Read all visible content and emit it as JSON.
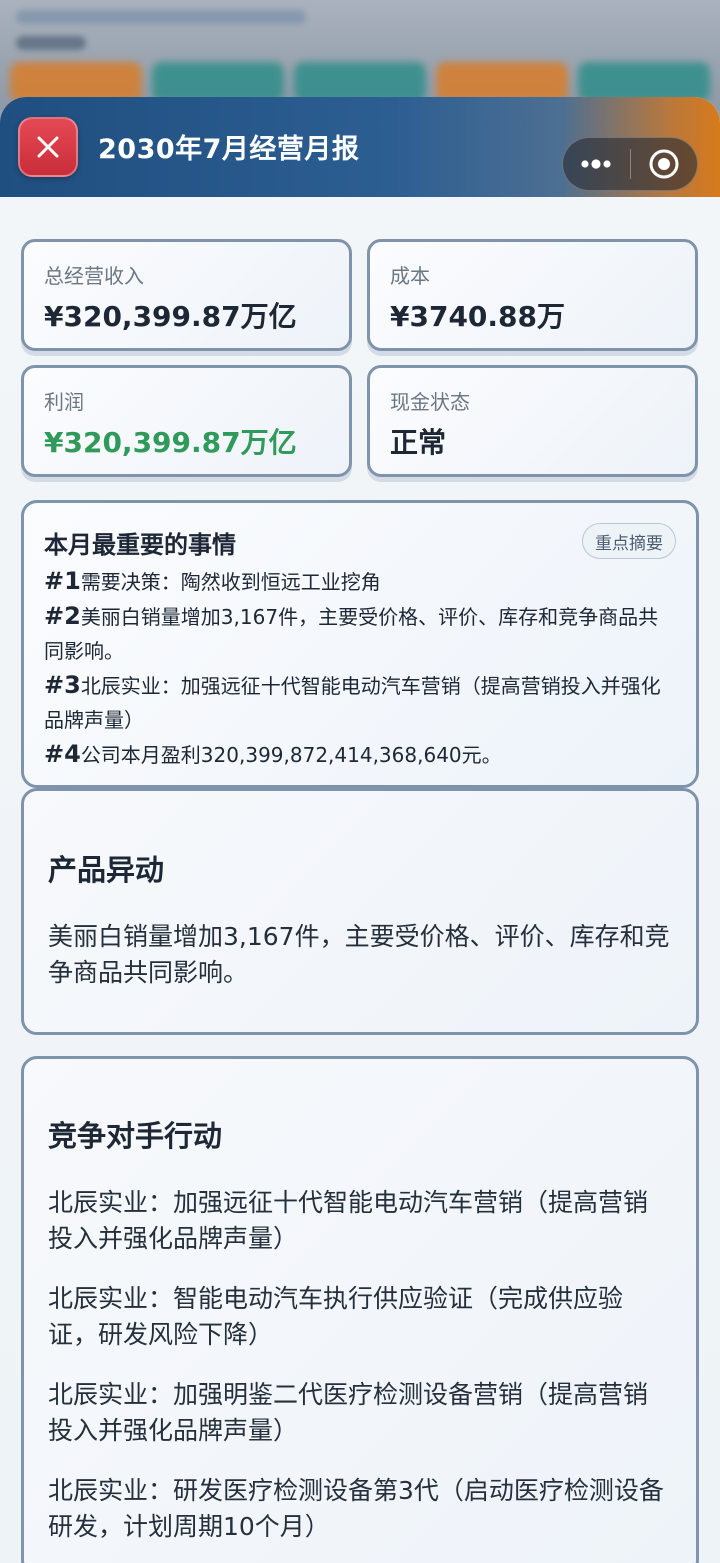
{
  "header": {
    "title": "2030年7月经营月报"
  },
  "stats": [
    {
      "label": "总经营收入",
      "value": "¥320,399.87万亿"
    },
    {
      "label": "成本",
      "value": "¥3740.88万"
    },
    {
      "label": "利润",
      "value": "¥320,399.87万亿"
    },
    {
      "label": "现金状态",
      "value": "正常"
    }
  ],
  "highlights": {
    "title": "本月最重要的事情",
    "badge": "重点摘要",
    "items": [
      {
        "num": "#1",
        "text": "需要决策：陶然收到恒远工业挖角"
      },
      {
        "num": "#2",
        "text": "美丽白销量增加3,167件，主要受价格、评价、库存和竞争商品共同影响。"
      },
      {
        "num": "#3",
        "text": "北辰实业：加强远征十代智能电动汽车营销（提高营销投入并强化品牌声量）"
      },
      {
        "num": "#4",
        "text": "公司本月盈利320,399,872,414,368,640元。"
      }
    ]
  },
  "product_section": {
    "title": "产品异动",
    "text": "美丽白销量增加3,167件，主要受价格、评价、库存和竞争商品共同影响。"
  },
  "competitor_section": {
    "title": "竞争对手行动",
    "items": [
      "北辰实业：加强远征十代智能电动汽车营销（提高营销投入并强化品牌声量）",
      "北辰实业：智能电动汽车执行供应验证（完成供应验证，研发风险下降）",
      "北辰实业：加强明鉴二代医疗检测设备营销（提高营销投入并强化品牌声量）",
      "北辰实业：研发医疗检测设备第3代（启动医疗检测设备研发，计划周期10个月）"
    ]
  },
  "colors": {
    "profit_green": "#2f9a59",
    "close_red": "#d63a45",
    "header_blue": "#1f4f80",
    "header_orange": "#d77a1c"
  },
  "icons": {
    "close": "close-icon",
    "more": "more-dots-icon",
    "target": "target-icon"
  }
}
